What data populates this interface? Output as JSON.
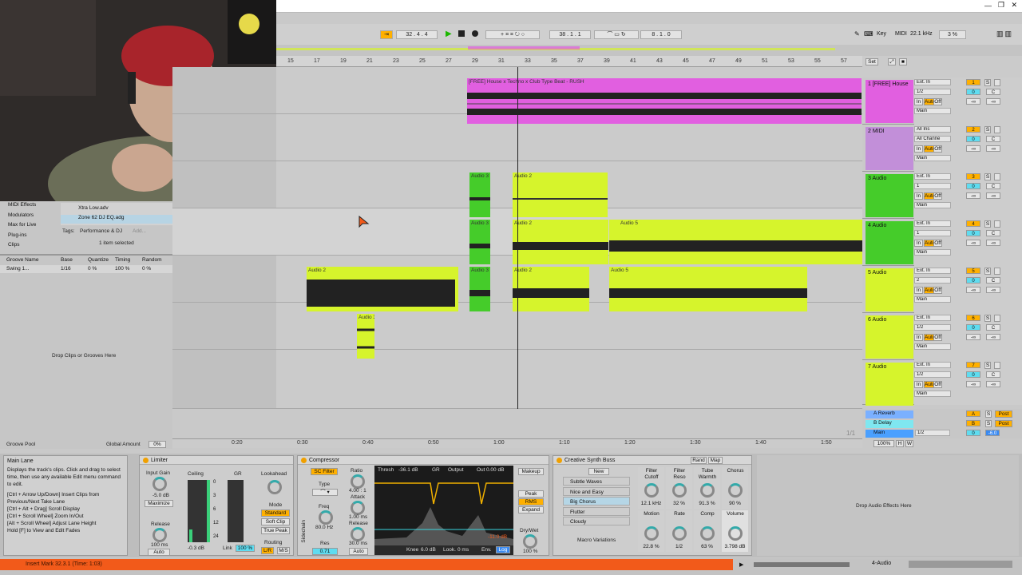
{
  "transport": {
    "position": "32 . 4 . 4",
    "loop_start": "38 . 1 . 1",
    "loop_length": "8 . 1 . 0",
    "key_label": "Key",
    "midi_label": "MIDI",
    "sample_rate": "22.1 kHz",
    "cpu": "3 %"
  },
  "ruler": {
    "bars": [
      "15",
      "17",
      "19",
      "21",
      "23",
      "25",
      "27",
      "29",
      "31",
      "33",
      "35",
      "37",
      "39",
      "41",
      "43",
      "45",
      "47",
      "49",
      "51",
      "53",
      "55",
      "57"
    ],
    "set_label": "Set"
  },
  "time_ruler": {
    "ticks": [
      "0:20",
      "0:30",
      "0:40",
      "0:50",
      "1:00",
      "1:10",
      "1:20",
      "1:30",
      "1:40",
      "1:50"
    ],
    "page": "1/1"
  },
  "clips": {
    "main_name": "[FREE] House x Techno x Club Type Beat - RUSH",
    "audio3": "Audio 3",
    "audio2": "Audio 2",
    "audio5": "Audio 5",
    "au": "Au"
  },
  "tracks": [
    {
      "name": "1 [FREE] House",
      "num": "1",
      "input": "Ext. In",
      "channel": "1/2",
      "out": "Main",
      "color": "#e15fe0",
      "s": "S"
    },
    {
      "name": "2 MIDI",
      "num": "2",
      "input": "All Ins",
      "channel": "All Channe",
      "out": "Main",
      "color": "#c28fd9",
      "s": "S"
    },
    {
      "name": "3 Audio",
      "num": "3",
      "input": "Ext. In",
      "channel": "1",
      "out": "Main",
      "color": "#45cc2a",
      "s": "S"
    },
    {
      "name": "4 Audio",
      "num": "4",
      "input": "Ext. In",
      "channel": "1",
      "out": "Main",
      "color": "#45cc2a",
      "s": "S"
    },
    {
      "name": "5 Audio",
      "num": "5",
      "input": "Ext. In",
      "channel": "2",
      "out": "Main",
      "color": "#d6f42c",
      "s": "S"
    },
    {
      "name": "6 Audio",
      "num": "6",
      "input": "Ext. In",
      "channel": "1/2",
      "out": "Main",
      "color": "#d6f42c",
      "s": "S"
    },
    {
      "name": "7 Audio",
      "num": "7",
      "input": "Ext. In",
      "channel": "1/2",
      "out": "Main",
      "color": "#d6f42c",
      "s": "S"
    }
  ],
  "monitor": {
    "in": "In",
    "auto": "Auto",
    "off": "Off",
    "vol": "0",
    "pan": "C",
    "inf": "-∞"
  },
  "returns": [
    {
      "name": "A Reverb",
      "letter": "A",
      "post": "Post",
      "color": "#7ab0ff"
    },
    {
      "name": "B Delay",
      "letter": "B",
      "post": "Post",
      "color": "#7fe7f0"
    },
    {
      "name": "Main",
      "letter": "",
      "post": "",
      "color": "#4aa0ff"
    }
  ],
  "main_out": {
    "channel": "1/2",
    "vol": "0",
    "value": "-6.0"
  },
  "zoom": "100%",
  "browser": {
    "items": [
      "MIDI Effects",
      "Modulators",
      "Max for Live",
      "Plug-ins",
      "Clips"
    ],
    "files": [
      "Xtra Low.adv",
      "Zone 62 DJ EQ.adg"
    ],
    "tags_label": "Tags:",
    "tags": "Performance & DJ",
    "add": "Add...",
    "selected": "1 item selected"
  },
  "groove": {
    "cols": [
      "Groove Name",
      "Base",
      "Quantize",
      "Timing",
      "Random"
    ],
    "row": [
      "Swing 1...",
      "1/16",
      "0 %",
      "100 %",
      "0 %"
    ],
    "drop": "Drop Clips or Grooves Here",
    "pool": "Groove Pool",
    "amount_label": "Global Amount",
    "amount": "0%"
  },
  "info": {
    "title": "Main Lane",
    "body": "Displays the track's clips. Click and drag to select time, then use any available Edit menu command to edit.",
    "shortcuts": [
      "[Ctrl + Arrow Up/Down] Insert Clips from Previous/Next Take Lane",
      "[Ctrl + Alt + Drag] Scroll Display",
      "[Ctrl + Scroll Wheel] Zoom In/Out",
      "[Alt + Scroll Wheel] Adjust Lane Height",
      "Hold [F] to View and Edit Fades"
    ]
  },
  "limiter": {
    "title": "Limiter",
    "input_gain": "Input Gain",
    "input_val": "-5.0 dB",
    "maximize": "Maximize",
    "ceiling": "Ceiling",
    "gr": "GR",
    "lookahead": "Lookahead",
    "release": "Release",
    "release_val": "100 ms",
    "auto": "Auto",
    "mode": "Mode",
    "standard": "Standard",
    "soft_clip": "Soft Clip",
    "true_peak": "True Peak",
    "routing": "Routing",
    "lr": "L/R",
    "ms": "M/S",
    "ceiling_val": "-0.3 dB",
    "link": "Link",
    "link_val": "100 %",
    "scale": [
      "0",
      "3",
      "6",
      "12",
      "24"
    ]
  },
  "compressor": {
    "title": "Compressor",
    "sc_filter": "SC Filter",
    "type": "Type",
    "freq": "Freq",
    "freq_val": "80.0 Hz",
    "res": "Res",
    "res_val": "0.71",
    "ratio": "Ratio",
    "ratio_val": "4.00 : 1",
    "attack": "Attack",
    "attack_val": "1.00 ms",
    "release": "Release",
    "release_val": "30.0 ms",
    "auto": "Auto",
    "thresh": "Thresh",
    "thresh_val": "-36.1 dB",
    "gr": "GR",
    "output": "Output",
    "out": "Out",
    "out_val": "0.00 dB",
    "makeup": "Makeup",
    "peak": "Peak",
    "rms": "RMS",
    "expand": "Expand",
    "drywet": "Dry/Wet",
    "drywet_val": "100 %",
    "knee": "Knee",
    "knee_val": "6.0 dB",
    "look": "Look.",
    "look_val": "0 ms",
    "env": "Env.",
    "log": "Log",
    "gr_val": "-11.0 dB",
    "sidechain": "Sidechain"
  },
  "synthbuss": {
    "title": "Creative Synth Buss",
    "rand": "Rand",
    "map": "Map",
    "new": "New",
    "presets": [
      "Subtle Waves",
      "Nice and Easy",
      "Big Chorus",
      "Flutter",
      "Cloudy"
    ],
    "macro_variations": "Macro Variations",
    "macros": [
      {
        "name": "Filter Cutoff",
        "val": "12.1 kHz"
      },
      {
        "name": "Filter Reso",
        "val": "32 %"
      },
      {
        "name": "Tube Warmth",
        "val": "91.3 %"
      },
      {
        "name": "Chorus",
        "val": "90 %"
      },
      {
        "name": "Motion",
        "val": "22.8 %"
      },
      {
        "name": "Rate",
        "val": "1/2"
      },
      {
        "name": "Comp",
        "val": "63 %"
      },
      {
        "name": "Volume",
        "val": "3.798 dB"
      }
    ]
  },
  "drop_effects": "Drop Audio Effects Here",
  "status": {
    "message": "Insert Mark 32.3.1 (Time: 1:03)",
    "track": "4-Audio"
  },
  "colors": {
    "pink": "#e15fe0",
    "green": "#45cc2a",
    "yellow": "#d6f42c",
    "orange": "#f25a1a",
    "accent": "#ffb000"
  }
}
